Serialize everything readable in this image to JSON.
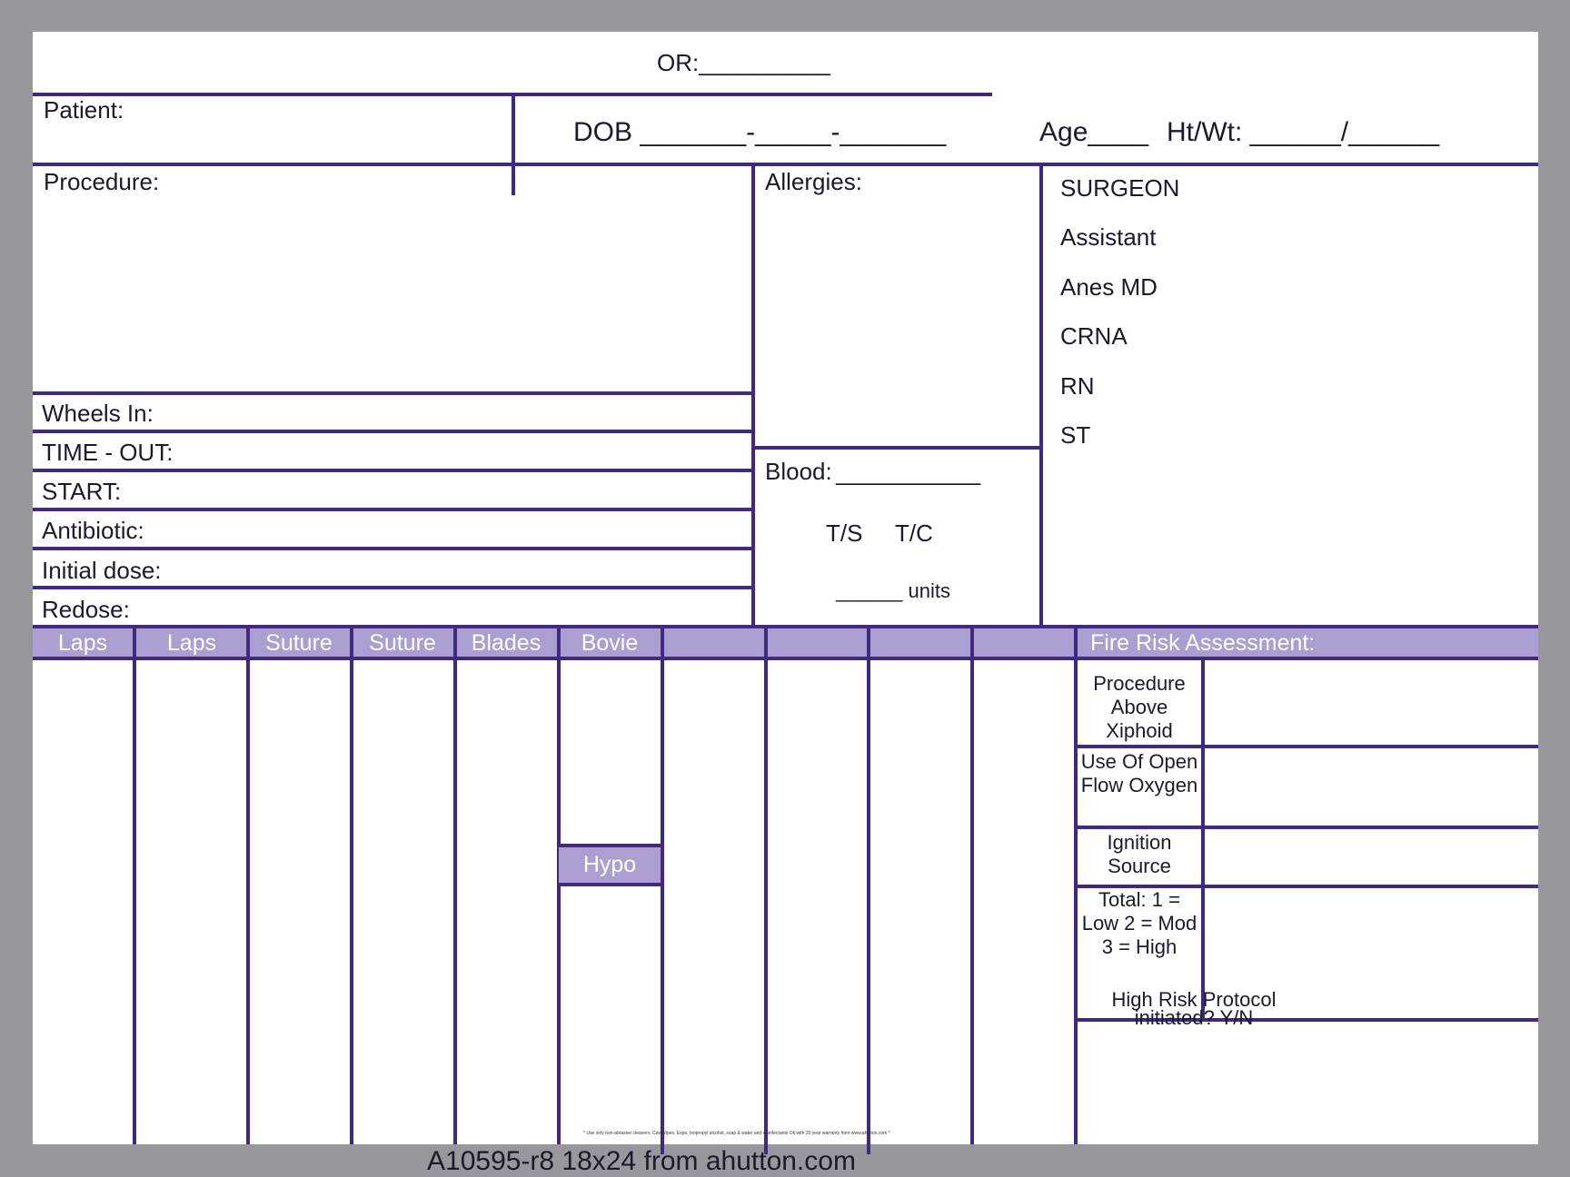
{
  "header": {
    "or": "OR:__________",
    "patient": "Patient:",
    "dob": "DOB  _______-_____-_______",
    "age": "Age____",
    "htwt": "Ht/Wt: ______/______"
  },
  "left_labels": {
    "procedure": "Procedure:",
    "wheels_in": "Wheels In:",
    "time_out": "TIME - OUT:",
    "start": "START:",
    "antibiotic": "Antibiotic:",
    "initial_dose": "Initial dose:",
    "redose": "Redose:"
  },
  "allergies": "Allergies:",
  "blood": {
    "label": "Blood:",
    "line": "___________",
    "ts": "T/S",
    "tc": "T/C",
    "units": "______ units"
  },
  "staff": [
    "SURGEON",
    "Assistant",
    "Anes MD",
    "CRNA",
    "RN",
    "ST"
  ],
  "count_columns": [
    "Laps",
    "Laps",
    "Suture",
    "Suture",
    "Blades",
    "Bovie",
    "",
    "",
    "",
    ""
  ],
  "hypo": "Hypo",
  "fire_risk": {
    "title": "Fire Risk Assessment:",
    "rows": [
      "Procedure Above Xiphoid",
      "Use Of Open Flow Oxygen",
      "Ignition Source",
      "Total: 1 = Low 2 = Mod 3 = High"
    ],
    "protocol": "High Risk Protocol initiated? Y/N"
  },
  "fine_print": "* Use only non-abrasive cleaners.    CaviWipes, Expo, Isopropyl alcohol, soap &    water and disinfectants Ok with 20 year warranty from www.ahutton.com *",
  "footer": "A10595-r8  18x24  from ahutton.com"
}
